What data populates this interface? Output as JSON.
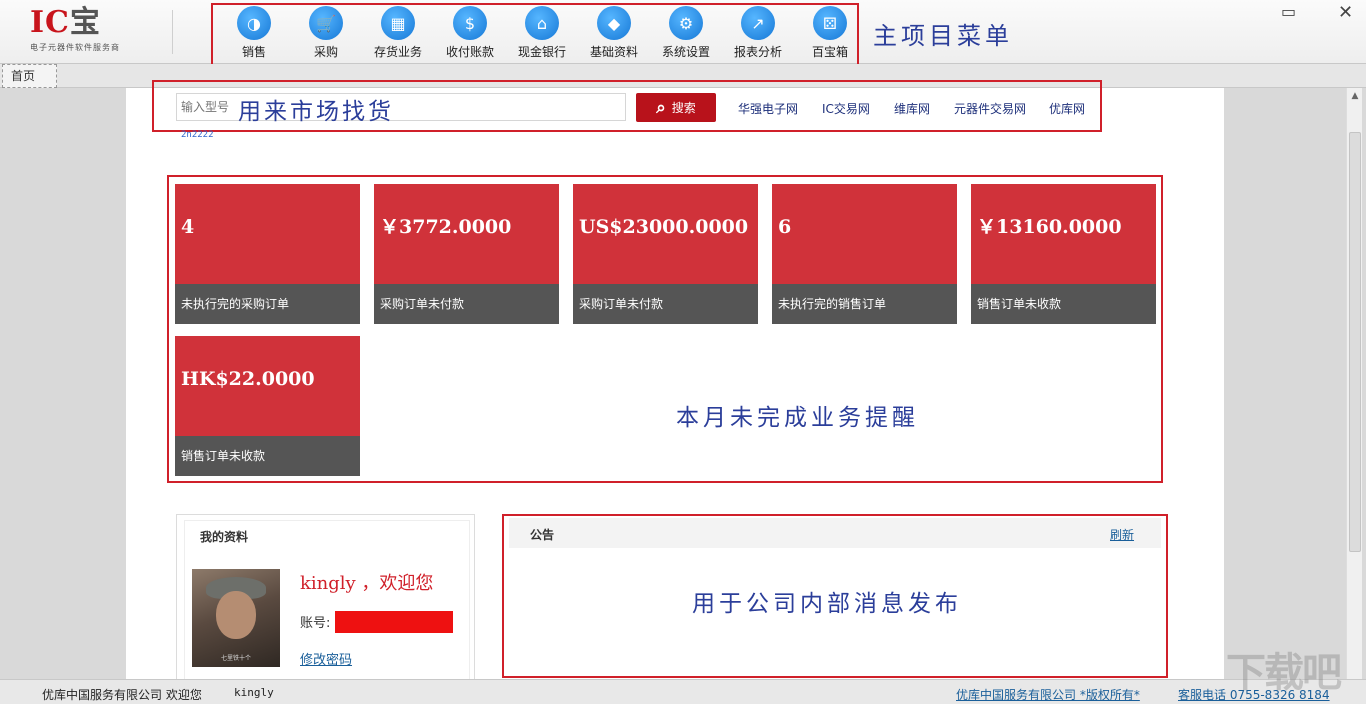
{
  "logo": {
    "brand_main": "IC",
    "brand_accent": "宝",
    "subtitle": "电子元器件软件服务商"
  },
  "menu": {
    "items": [
      {
        "label": "销售",
        "icon": "sales-icon",
        "glyph": "◑"
      },
      {
        "label": "采购",
        "icon": "cart-icon",
        "glyph": "🛒"
      },
      {
        "label": "存货业务",
        "icon": "warehouse-icon",
        "glyph": "▦"
      },
      {
        "label": "收付账款",
        "icon": "money-icon",
        "glyph": "$"
      },
      {
        "label": "现金银行",
        "icon": "bank-icon",
        "glyph": "⌂"
      },
      {
        "label": "基础资料",
        "icon": "box-icon",
        "glyph": "◆"
      },
      {
        "label": "系统设置",
        "icon": "gears-icon",
        "glyph": "⚙"
      },
      {
        "label": "报表分析",
        "icon": "chart-line-icon",
        "glyph": "↗"
      },
      {
        "label": "百宝箱",
        "icon": "dice-icon",
        "glyph": "⚄"
      }
    ],
    "annotation": "主项目菜单"
  },
  "window": {
    "feedback_icon": "chat-icon",
    "close_icon": "close-icon"
  },
  "tabs": [
    {
      "label": "首页"
    }
  ],
  "search": {
    "placeholder": "输入型号",
    "annotation": "用来市场找货",
    "button_label": "搜索",
    "hint": "2n2222",
    "links": [
      "华强电子网",
      "IC交易网",
      "维库网",
      "元器件交易网",
      "优库网"
    ]
  },
  "reminders": {
    "annotation": "本月未完成业务提醒",
    "tiles": [
      {
        "value": "4",
        "label": "未执行完的采购订单"
      },
      {
        "value": "￥3772.0000",
        "label": "采购订单未付款"
      },
      {
        "value": "US$23000.0000",
        "label": "采购订单未付款"
      },
      {
        "value": "6",
        "label": "未执行完的销售订单"
      },
      {
        "value": "￥13160.0000",
        "label": "销售订单未收款"
      },
      {
        "value": "HK$22.0000",
        "label": "销售订单未收款"
      }
    ]
  },
  "profile": {
    "title": "我的资料",
    "welcome": "kingly ，欢迎您",
    "account_label": "账号:",
    "change_password": "修改密码",
    "avatar_caption": "七里铁十个"
  },
  "notice": {
    "title": "公告",
    "refresh": "刷新",
    "annotation": "用于公司内部消息发布"
  },
  "status": {
    "company_welcome": "优库中国服务有限公司 欢迎您",
    "user": "kingly",
    "copyright": "优库中国服务有限公司 *版权所有*",
    "phone": "客服电话 0755-8326 8184"
  },
  "watermark": "下载吧",
  "colors": {
    "accent_red": "#d0323a",
    "tile_label_bg": "#555555",
    "annotation_blue": "#2b3e9a",
    "menu_icon_blue": "#1678d6"
  }
}
